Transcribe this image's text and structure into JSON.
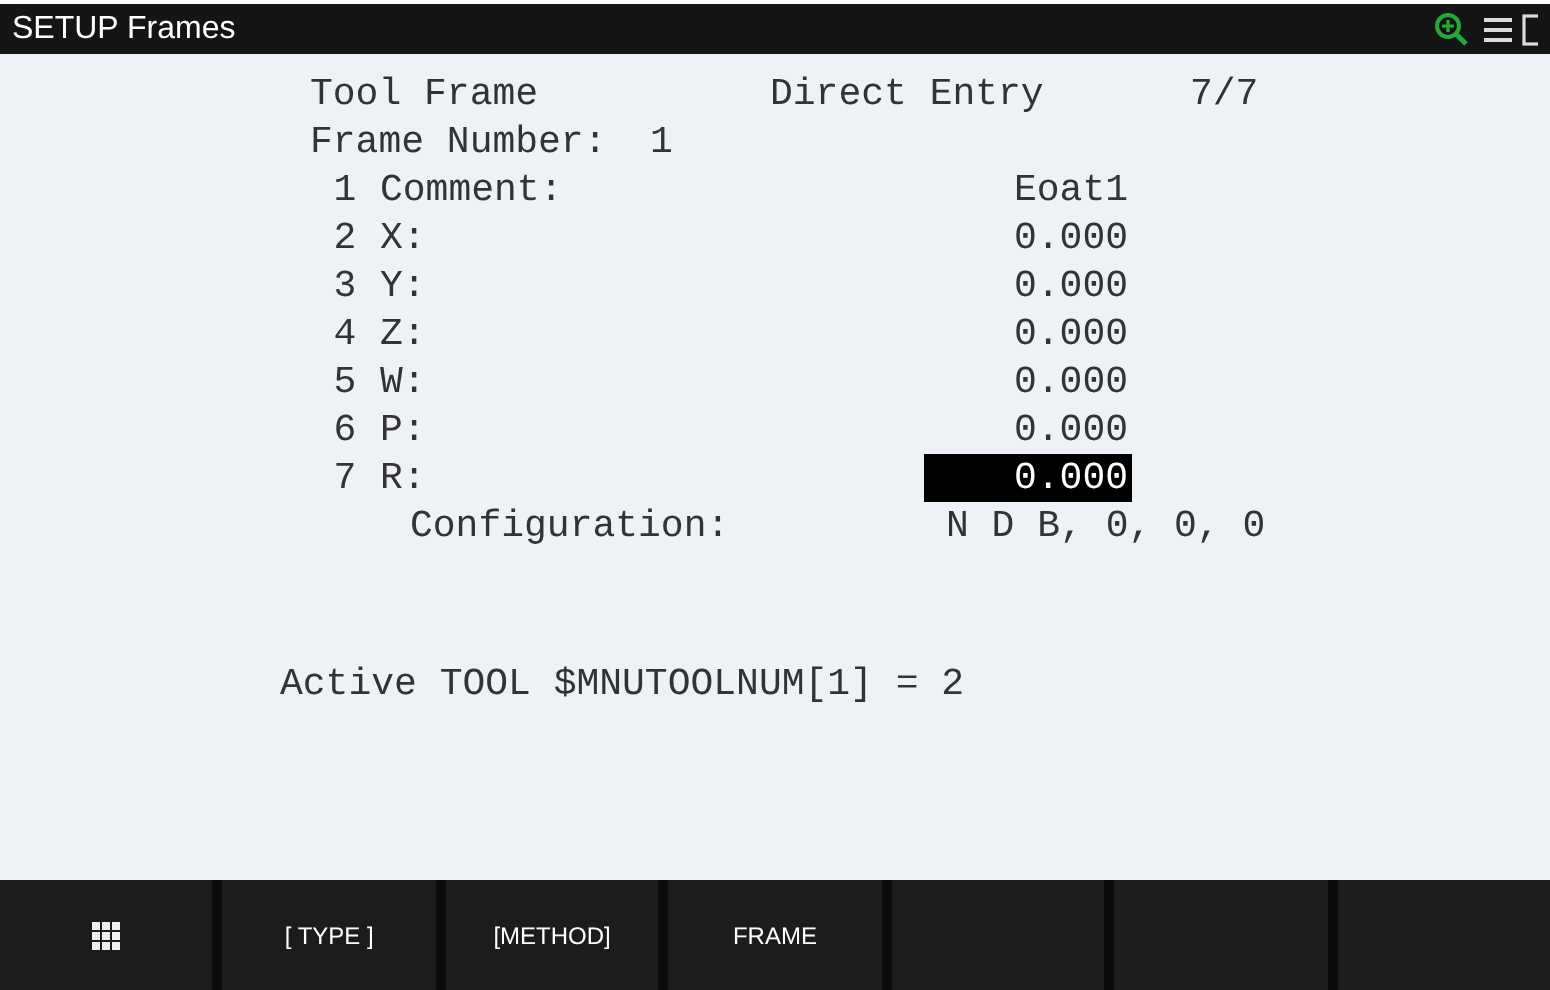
{
  "window": {
    "title": "SETUP Frames"
  },
  "header": {
    "frame_type": "Tool Frame",
    "method": "Direct Entry",
    "position": "7/7"
  },
  "frame_number": {
    "label": "Frame Number:",
    "value": "1"
  },
  "items": [
    {
      "number": "1",
      "label": "Comment:",
      "value": "Eoat1",
      "selected": false
    },
    {
      "number": "2",
      "label": "X:",
      "value": "0.000",
      "selected": false
    },
    {
      "number": "3",
      "label": "Y:",
      "value": "0.000",
      "selected": false
    },
    {
      "number": "4",
      "label": "Z:",
      "value": "0.000",
      "selected": false
    },
    {
      "number": "5",
      "label": "W:",
      "value": "0.000",
      "selected": false
    },
    {
      "number": "6",
      "label": "P:",
      "value": "0.000",
      "selected": false
    },
    {
      "number": "7",
      "label": "R:",
      "value": "0.000",
      "selected": true
    }
  ],
  "configuration": {
    "label": "Configuration:",
    "value": "N D B, 0, 0, 0"
  },
  "status_line": "Active TOOL $MNUTOOLNUM[1] = 2",
  "function_keys": [
    {
      "kind": "menu-grid"
    },
    {
      "kind": "text",
      "label": "[ TYPE ]"
    },
    {
      "kind": "text",
      "label": "[METHOD]"
    },
    {
      "kind": "text",
      "label": "FRAME"
    },
    {
      "kind": "blank"
    },
    {
      "kind": "blank"
    },
    {
      "kind": "blank"
    }
  ]
}
